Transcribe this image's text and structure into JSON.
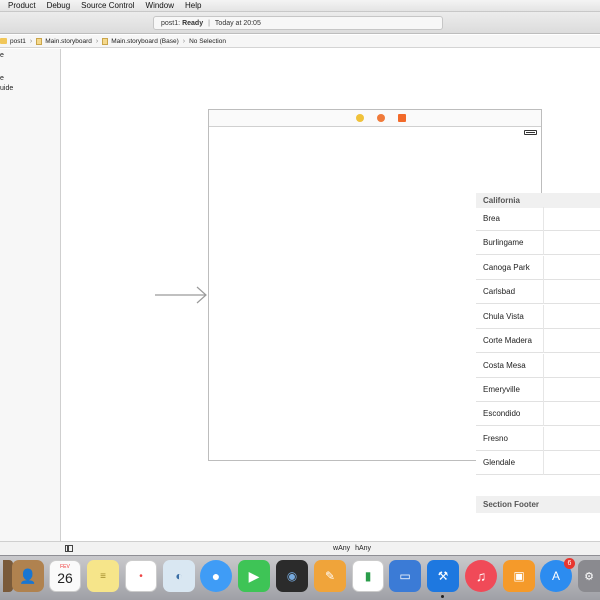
{
  "menu": {
    "items": [
      "Product",
      "Debug",
      "Source Control",
      "Window",
      "Help"
    ]
  },
  "toolbar": {
    "project": "post1:",
    "status": "Ready",
    "time": "Today at 20:05"
  },
  "jumpbar": {
    "crumbs": [
      "post1",
      "Main.storyboard",
      "Main.storyboard (Base)",
      "No Selection"
    ]
  },
  "navigator": {
    "items": [
      "e",
      "e",
      "uide"
    ]
  },
  "table": {
    "section_header": "California",
    "rows": [
      "Brea",
      "Burlingame",
      "Canoga Park",
      "Carlsbad",
      "Chula Vista",
      "Corte Madera",
      "Costa Mesa",
      "Emeryville",
      "Escondido",
      "Fresno",
      "Glendale"
    ],
    "section_footer": "Section Footer"
  },
  "bottombar": {
    "width_class": "Any",
    "height_class": "Any"
  },
  "dock": {
    "calendar_month": "FEV",
    "calendar_day": "26",
    "app_store_badge": "6",
    "icons": [
      "contacts-icon",
      "calendar-icon",
      "notes-icon",
      "reminders-icon",
      "preview-icon",
      "messages-icon",
      "facetime-icon",
      "photo-booth-icon",
      "pages-icon",
      "numbers-icon",
      "keynote-icon",
      "xcode-icon",
      "itunes-icon",
      "ibooks-icon",
      "app-store-icon",
      "system-preferences-icon"
    ]
  },
  "colors": {
    "accent_red": "#e8362f",
    "section_bg": "#f0f0f0",
    "dock_bg": "#b4b5ba"
  }
}
